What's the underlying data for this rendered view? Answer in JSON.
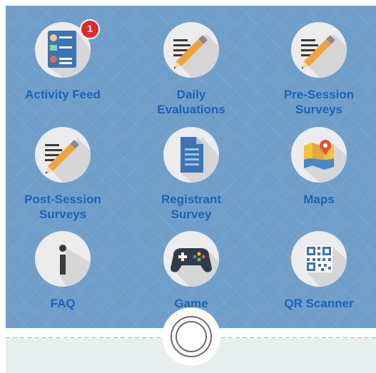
{
  "tiles": {
    "activity_feed": {
      "label_line1": "Activity Feed",
      "label_line2": "",
      "badge": "1",
      "icon": "activity-feed-icon"
    },
    "daily_evaluations": {
      "label_line1": "Daily",
      "label_line2": "Evaluations",
      "icon": "pencil-note-icon"
    },
    "pre_session": {
      "label_line1": "Pre-Session",
      "label_line2": "Surveys",
      "icon": "pencil-note-icon"
    },
    "post_session": {
      "label_line1": "Post-Session",
      "label_line2": "Surveys",
      "icon": "pencil-note-icon"
    },
    "registrant": {
      "label_line1": "Registrant",
      "label_line2": "Survey",
      "icon": "document-icon"
    },
    "maps": {
      "label_line1": "Maps",
      "label_line2": "",
      "icon": "map-icon"
    },
    "faq": {
      "label_line1": "FAQ",
      "label_line2": "",
      "icon": "info-icon"
    },
    "game": {
      "label_line1": "Game",
      "label_line2": "",
      "icon": "gamepad-icon"
    },
    "qr_scanner": {
      "label_line1": "QR Scanner",
      "label_line2": "",
      "icon": "qr-code-icon"
    }
  },
  "colors": {
    "background": "#6f9fc8",
    "label": "#1e64b4",
    "badge": "#e8232a",
    "icon_circle": "#ececec"
  }
}
